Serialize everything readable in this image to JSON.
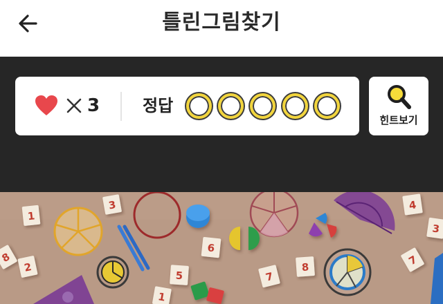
{
  "header": {
    "title": "틀린그림찾기",
    "back_icon": "arrow-left-icon"
  },
  "status": {
    "life_icon": "heart-icon",
    "multiply_icon": "times-icon",
    "lives": "3",
    "answer_label": "정답",
    "answers_total": 5,
    "answers_found": 0
  },
  "hint": {
    "label": "힌트보기",
    "icon": "magnifier-icon"
  },
  "puzzle": {
    "tiles": [
      "1",
      "3",
      "6",
      "4",
      "3",
      "8",
      "5",
      "7",
      "8",
      "7",
      "2",
      "1"
    ]
  },
  "colors": {
    "accent_yellow": "#f2d53c",
    "heart_red": "#e8474c",
    "header_bg": "#ffffff",
    "panel_bg": "#262626",
    "board_bg": "#b99a86"
  }
}
